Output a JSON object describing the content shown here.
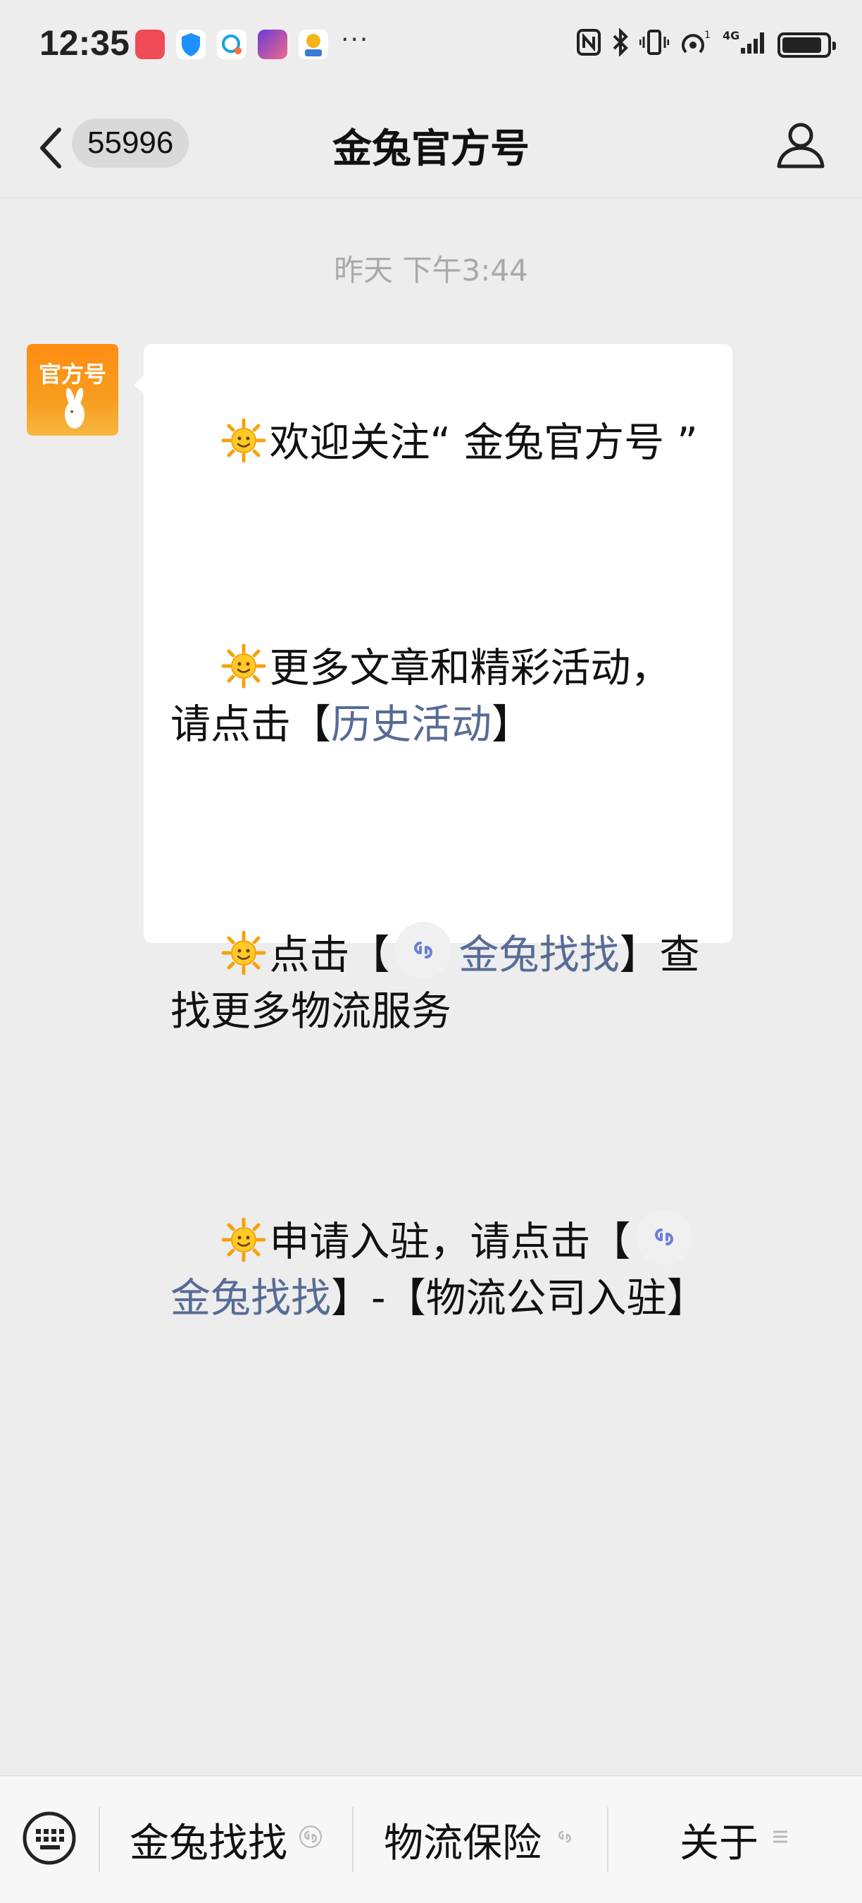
{
  "status_bar": {
    "time": "12:35",
    "more": "···",
    "signal_label": "4G",
    "battery_percent": 90
  },
  "nav": {
    "unread_count": "55996",
    "title": "金兔官方号"
  },
  "chat": {
    "timestamp": "昨天 下午3:44",
    "avatar_text": "官方号",
    "message": {
      "p1_text": "欢迎关注“ 金兔官方号 ”",
      "p2_text": "更多文章和精彩活动，请点击【",
      "p2_link": "历史活动",
      "p2_end": "】",
      "p3_start": "点击【",
      "p3_link": "金兔找找",
      "p3_end": "】查找更多物流服务",
      "p4_start": "申请入驻，请点击【",
      "p4_link": "金兔找找",
      "p4_end": "】-【物流公司入驻】"
    }
  },
  "bottom_menu": {
    "items": [
      {
        "label": "金兔找找",
        "icon": "mini-program-icon"
      },
      {
        "label": "物流保险",
        "icon": "mini-program-icon"
      },
      {
        "label": "关于",
        "icon": "submenu-icon"
      }
    ]
  },
  "colors": {
    "background": "#ededed",
    "bubble": "#ffffff",
    "link": "#576b95",
    "avatar_orange": "#ff8c12"
  }
}
